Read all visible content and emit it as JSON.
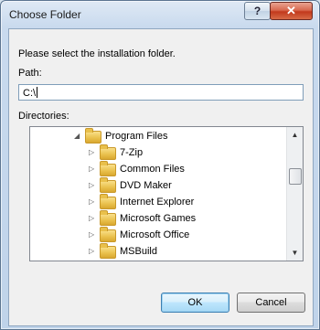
{
  "window": {
    "title": "Choose Folder",
    "help_label": "?",
    "close_label": "✕"
  },
  "prompt": "Please select the installation folder.",
  "path": {
    "label": "Path:",
    "value": "C:\\"
  },
  "directories": {
    "label": "Directories:",
    "items": [
      {
        "label": "Program Files",
        "expanded": true,
        "indent": 0
      },
      {
        "label": "7-Zip",
        "expanded": false,
        "indent": 1
      },
      {
        "label": "Common Files",
        "expanded": false,
        "indent": 1
      },
      {
        "label": "DVD Maker",
        "expanded": false,
        "indent": 1
      },
      {
        "label": "Internet Explorer",
        "expanded": false,
        "indent": 1
      },
      {
        "label": "Microsoft Games",
        "expanded": false,
        "indent": 1
      },
      {
        "label": "Microsoft Office",
        "expanded": false,
        "indent": 1
      },
      {
        "label": "MSBuild",
        "expanded": false,
        "indent": 1
      }
    ]
  },
  "buttons": {
    "ok": "OK",
    "cancel": "Cancel"
  },
  "icons": {
    "expanded": "triangle-down-icon",
    "collapsed": "triangle-right-icon",
    "folder": "folder-icon"
  }
}
